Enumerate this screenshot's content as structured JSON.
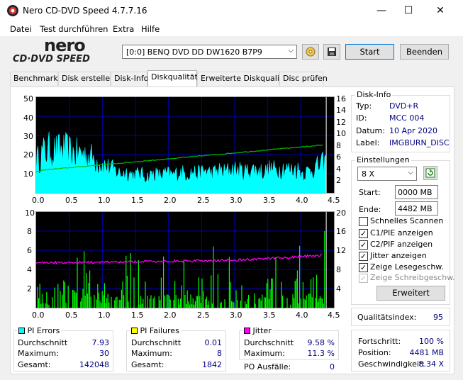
{
  "window": {
    "title": "Nero CD-DVD Speed 4.7.7.16",
    "minimize": "—",
    "maximize": "☐",
    "close": "✕"
  },
  "menu": [
    "Datei",
    "Test durchführen",
    "Extra",
    "Hilfe"
  ],
  "logo": {
    "line1": "nero",
    "line2": "CD·DVD SPEED"
  },
  "toolbar": {
    "drive": "[0:0]   BENQ DVD DD DW1620 B7P9",
    "start": "Start",
    "quit": "Beenden"
  },
  "tabs": [
    "Benchmark",
    "Disk erstellen",
    "Disk-Info",
    "Diskqualität",
    "Erweiterte Diskqualität",
    "Disc prüfen"
  ],
  "chart_data": [
    {
      "type": "area",
      "name": "PI Errors / Read speed",
      "x_ticks": [
        "0.0",
        "0.5",
        "1.0",
        "1.5",
        "2.0",
        "2.5",
        "3.0",
        "3.5",
        "4.0",
        "4.5"
      ],
      "y_left_ticks": [
        "50",
        "40",
        "30",
        "20",
        "10"
      ],
      "y_right_ticks": [
        "16",
        "14",
        "12",
        "10",
        "8",
        "6",
        "4",
        "2"
      ],
      "xlim": [
        0,
        4.5
      ],
      "ylim": [
        0,
        50
      ],
      "y2lim": [
        0,
        16
      ],
      "pi_envelope": [
        [
          0,
          20
        ],
        [
          0.05,
          22
        ],
        [
          0.1,
          25
        ],
        [
          0.2,
          27
        ],
        [
          0.3,
          26
        ],
        [
          0.4,
          27
        ],
        [
          0.5,
          26
        ],
        [
          0.6,
          24
        ],
        [
          0.7,
          25
        ],
        [
          0.8,
          23
        ],
        [
          0.9,
          21
        ],
        [
          1.0,
          18
        ],
        [
          1.1,
          16
        ],
        [
          1.2,
          14
        ],
        [
          1.3,
          12
        ],
        [
          1.4,
          13
        ],
        [
          1.5,
          11
        ],
        [
          1.6,
          12
        ],
        [
          1.7,
          10
        ],
        [
          1.8,
          12
        ],
        [
          1.9,
          11
        ],
        [
          2.0,
          12
        ],
        [
          2.1,
          11
        ],
        [
          2.2,
          13
        ],
        [
          2.3,
          12
        ],
        [
          2.4,
          13
        ],
        [
          2.5,
          12
        ],
        [
          2.6,
          14
        ],
        [
          2.7,
          12
        ],
        [
          2.8,
          14
        ],
        [
          2.9,
          13
        ],
        [
          3.0,
          15
        ],
        [
          3.1,
          14
        ],
        [
          3.2,
          13
        ],
        [
          3.3,
          15
        ],
        [
          3.4,
          14
        ],
        [
          3.5,
          13
        ],
        [
          3.6,
          15
        ],
        [
          3.7,
          14
        ],
        [
          3.8,
          16
        ],
        [
          3.9,
          14
        ],
        [
          4.0,
          15
        ],
        [
          4.1,
          12
        ],
        [
          4.2,
          14
        ],
        [
          4.3,
          16
        ],
        [
          4.4,
          18
        ],
        [
          4.45,
          20
        ]
      ],
      "speed_line": [
        [
          0,
          3.5
        ],
        [
          0.1,
          3.8
        ],
        [
          4.4,
          8.0
        ]
      ],
      "colors": {
        "pi": "#00ffff",
        "speed": "#00c000",
        "grid": "#0000b0"
      }
    },
    {
      "type": "bar",
      "name": "PI Failures / Jitter",
      "x_ticks": [
        "0.0",
        "0.5",
        "1.0",
        "1.5",
        "2.0",
        "2.5",
        "3.0",
        "3.5",
        "4.0",
        "4.5"
      ],
      "y_left_ticks": [
        "10",
        "8",
        "6",
        "4",
        "2"
      ],
      "y_right_ticks": [
        "20",
        "16",
        "12",
        "8",
        "4"
      ],
      "xlim": [
        0,
        4.5
      ],
      "ylim": [
        0,
        10
      ],
      "y2lim": [
        0,
        20
      ],
      "jitter_line": [
        [
          0,
          9.4
        ],
        [
          1.0,
          9.5
        ],
        [
          2.0,
          9.7
        ],
        [
          3.0,
          9.9
        ],
        [
          4.0,
          10.6
        ],
        [
          4.4,
          11.0
        ]
      ],
      "colors": {
        "pif": "#00ff00",
        "jitter": "#ff00ff",
        "grid": "#0000b0"
      }
    }
  ],
  "diskinfo": {
    "title": "Disk-Info",
    "typ_label": "Typ:",
    "typ": "DVD+R",
    "id_label": "ID:",
    "id": "MCC 004",
    "datum_label": "Datum:",
    "datum": "10 Apr 2020",
    "label_label": "Label:",
    "label": "IMGBURN_DISC"
  },
  "settings": {
    "title": "Einstellungen",
    "speed": "8 X",
    "start_label": "Start:",
    "start": "0000 MB",
    "end_label": "Ende:",
    "end": "4482 MB",
    "checks": [
      {
        "label": "Schnelles Scannen",
        "checked": false,
        "disabled": false
      },
      {
        "label": "C1/PIE anzeigen",
        "checked": true,
        "disabled": false
      },
      {
        "label": "C2/PIF anzeigen",
        "checked": true,
        "disabled": false
      },
      {
        "label": "Jitter anzeigen",
        "checked": true,
        "disabled": false
      },
      {
        "label": "Zeige Lesegeschw.",
        "checked": true,
        "disabled": false
      },
      {
        "label": "Zeige Schreibgeschw.",
        "checked": true,
        "disabled": true
      }
    ],
    "advanced": "Erweitert"
  },
  "quality": {
    "label": "Qualitätsindex:",
    "value": "95"
  },
  "progress": {
    "fortschritt_label": "Fortschritt:",
    "fortschritt": "100 %",
    "position_label": "Position:",
    "position": "4481 MB",
    "speed_label": "Geschwindigkeit:",
    "speed": "8.34 X"
  },
  "pi_errors": {
    "title": "PI Errors",
    "color": "#00ffff",
    "avg_label": "Durchschnitt",
    "avg": "7.93",
    "max_label": "Maximum:",
    "max": "30",
    "total_label": "Gesamt:",
    "total": "142048"
  },
  "pi_failures": {
    "title": "PI Failures",
    "color": "#ffff00",
    "avg_label": "Durchschnitt",
    "avg": "0.01",
    "max_label": "Maximum:",
    "max": "8",
    "total_label": "Gesamt:",
    "total": "1842"
  },
  "jitter": {
    "title": "Jitter",
    "color": "#ff00ff",
    "avg_label": "Durchschnitt",
    "avg": "9.58 %",
    "max_label": "Maximum:",
    "max": "11.3 %",
    "po_label": "PO Ausfälle:",
    "po": "0"
  }
}
